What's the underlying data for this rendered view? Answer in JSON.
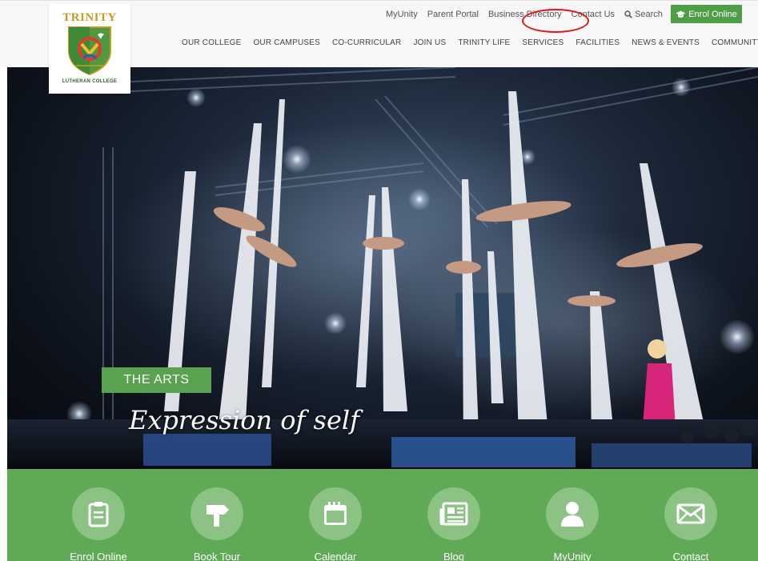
{
  "logo": {
    "top_word": "TRINITY",
    "bottom_word": "LUTHERAN COLLEGE",
    "name": "Trinity Lutheran College logo"
  },
  "utility_nav": {
    "links": [
      "MyUnity",
      "Parent Portal",
      "Business Directory",
      "Contact Us"
    ],
    "search_label": "Search",
    "enrol_label": "Enrol Online"
  },
  "main_nav": [
    "OUR COLLEGE",
    "OUR CAMPUSES",
    "CO-CURRICULAR",
    "JOIN US",
    "TRINITY LIFE",
    "SERVICES",
    "FACILITIES",
    "NEWS & EVENTS",
    "COMMUNITY"
  ],
  "hero": {
    "tag": "THE ARTS",
    "tagline": "Expression of self"
  },
  "quick_links": [
    {
      "label": "Enrol Online",
      "icon": "clipboard-icon"
    },
    {
      "label": "Book Tour",
      "icon": "signpost-icon"
    },
    {
      "label": "Calendar",
      "icon": "calendar-icon"
    },
    {
      "label": "Blog",
      "icon": "newspaper-icon"
    },
    {
      "label": "MyUnity",
      "icon": "user-icon"
    },
    {
      "label": "Contact",
      "icon": "envelope-icon"
    }
  ],
  "colors": {
    "brand_green": "#4d9e45",
    "quick_bar_green": "#60a957",
    "icon_circle": "#8cc284",
    "annotation_red": "#e3141b"
  }
}
